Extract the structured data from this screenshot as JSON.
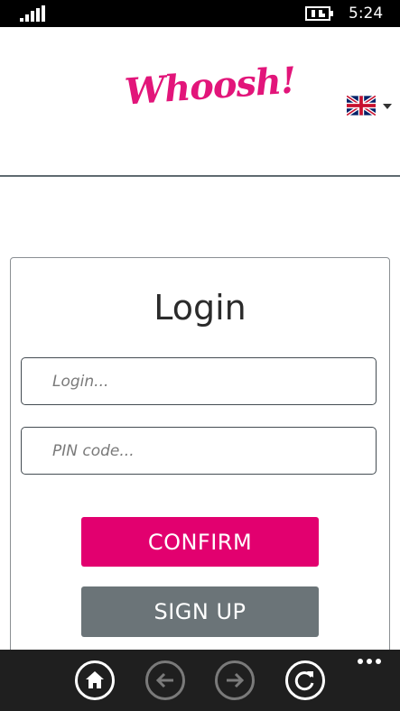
{
  "status_bar": {
    "time": "5:24",
    "signal_icon": "signal-strength-icon",
    "battery_icon": "battery-charging-icon"
  },
  "header": {
    "logo_text": "Whoosh!",
    "logo_color": "#e2157a",
    "language_icon": "uk-flag-icon"
  },
  "login": {
    "title": "Login",
    "login_placeholder": "Login...",
    "pin_placeholder": "PIN code...",
    "confirm_label": "CONFIRM",
    "signup_label": "SIGN UP"
  },
  "colors": {
    "accent": "#e2006f",
    "secondary_button": "#6b7478",
    "app_bar": "#1f1f1f"
  },
  "app_bar": {
    "buttons": [
      {
        "icon": "home-icon",
        "enabled": true
      },
      {
        "icon": "back-arrow-icon",
        "enabled": false
      },
      {
        "icon": "forward-arrow-icon",
        "enabled": false
      },
      {
        "icon": "refresh-icon",
        "enabled": true
      }
    ],
    "more_icon": "more-dots-icon"
  }
}
